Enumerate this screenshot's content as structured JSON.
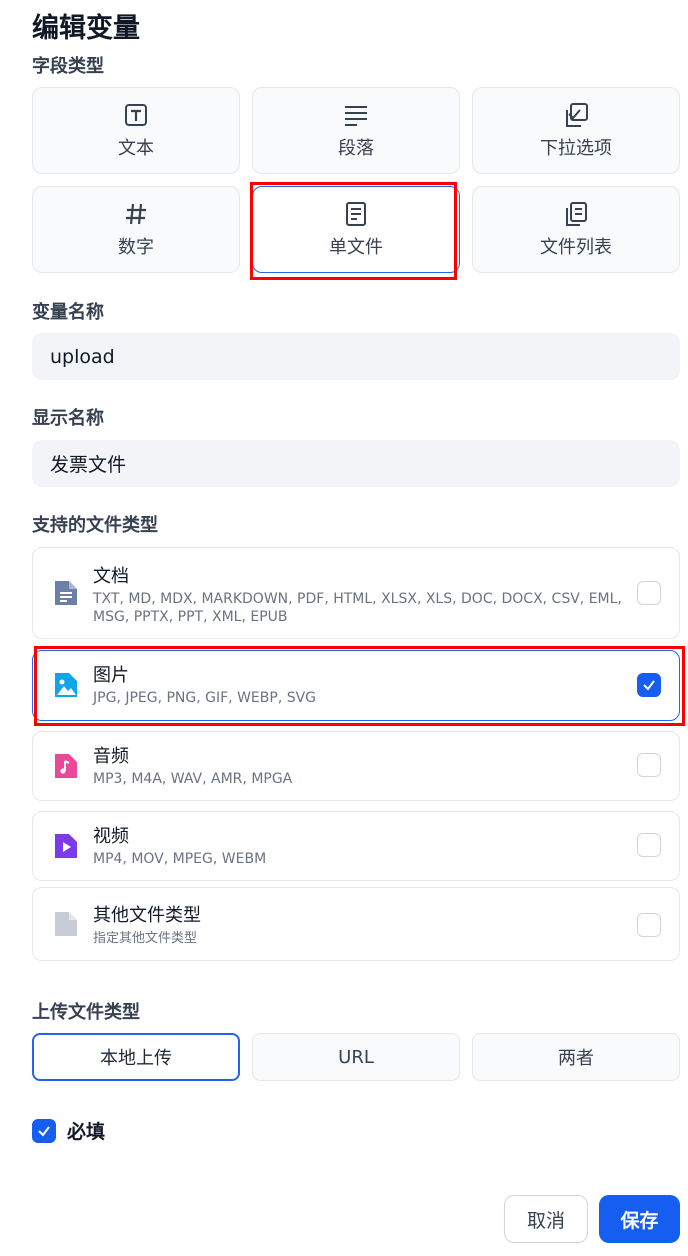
{
  "dialog": {
    "title": "编辑变量"
  },
  "field_type": {
    "label": "字段类型",
    "options": [
      {
        "label": "文本",
        "icon": "text-icon"
      },
      {
        "label": "段落",
        "icon": "paragraph-icon"
      },
      {
        "label": "下拉选项",
        "icon": "select-icon"
      },
      {
        "label": "数字",
        "icon": "hash-icon"
      },
      {
        "label": "单文件",
        "icon": "file-icon",
        "selected": true
      },
      {
        "label": "文件列表",
        "icon": "file-list-icon"
      }
    ]
  },
  "variable_name": {
    "label": "变量名称",
    "value": "upload"
  },
  "display_name": {
    "label": "显示名称",
    "value": "发票文件"
  },
  "supported_types": {
    "label": "支持的文件类型",
    "items": [
      {
        "name": "文档",
        "extensions": "TXT, MD, MDX, MARKDOWN, PDF, HTML, XLSX, XLS, DOC, DOCX, CSV, EML, MSG, PPTX, PPT, XML, EPUB",
        "checked": false,
        "icon": "document-icon",
        "color": "#6b7fa8"
      },
      {
        "name": "图片",
        "extensions": "JPG, JPEG, PNG, GIF, WEBP, SVG",
        "checked": true,
        "icon": "image-icon",
        "color": "#0ea5e9"
      },
      {
        "name": "音频",
        "extensions": "MP3, M4A, WAV, AMR, MPGA",
        "checked": false,
        "icon": "audio-icon",
        "color": "#ec4899"
      },
      {
        "name": "视频",
        "extensions": "MP4, MOV, MPEG, WEBM",
        "checked": false,
        "icon": "video-icon",
        "color": "#7c3aed"
      },
      {
        "name": "其他文件类型",
        "extensions": "指定其他文件类型",
        "checked": false,
        "icon": "other-file-icon",
        "color": "#c7ccd6"
      }
    ]
  },
  "upload_method": {
    "label": "上传文件类型",
    "options": [
      {
        "label": "本地上传",
        "selected": true
      },
      {
        "label": "URL"
      },
      {
        "label": "两者"
      }
    ]
  },
  "required": {
    "label": "必填",
    "checked": true
  },
  "actions": {
    "cancel": "取消",
    "save": "保存"
  },
  "colors": {
    "accent": "#155eef",
    "highlight": "#ff0000"
  }
}
